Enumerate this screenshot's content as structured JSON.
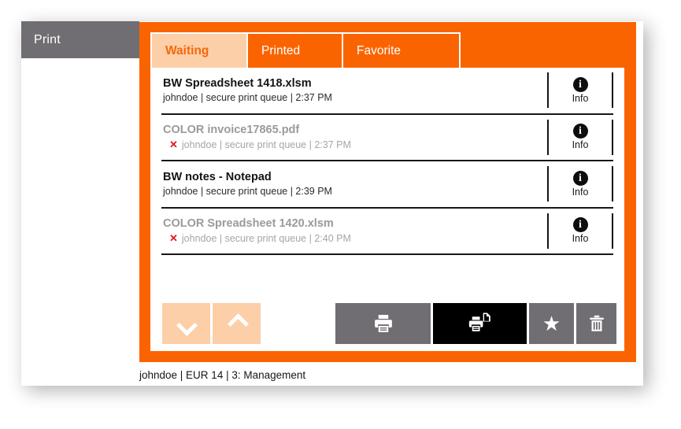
{
  "window": {
    "left_tab_label": "Print"
  },
  "tabs": [
    {
      "label": "Waiting",
      "active": true
    },
    {
      "label": "Printed",
      "active": false
    },
    {
      "label": "Favorite",
      "active": false
    }
  ],
  "job_list": {
    "info_label": "Info",
    "info_icon": "info-circle-icon",
    "error_mark": "✕",
    "items": [
      {
        "title": "BW Spreadsheet 1418.xlsm",
        "meta": "johndoe | secure print queue | 2:37 PM",
        "error": false,
        "state": "ready"
      },
      {
        "title": "COLOR invoice17865.pdf",
        "meta": "johndoe | secure print queue | 2:37 PM",
        "error": true,
        "state": "disabled"
      },
      {
        "title": "BW notes - Notepad",
        "meta": "johndoe | secure print queue | 2:39 PM",
        "error": false,
        "state": "ready"
      },
      {
        "title": "COLOR Spreadsheet 1420.xlsm",
        "meta": "johndoe | secure print queue | 2:40 PM",
        "error": true,
        "state": "disabled"
      }
    ]
  },
  "toolbar": {
    "scroll_down": {
      "name": "scroll-down-button",
      "icon": "chevron-down-icon"
    },
    "scroll_up": {
      "name": "scroll-up-button",
      "icon": "chevron-up-icon"
    },
    "print": {
      "name": "print-button",
      "icon": "printer-icon"
    },
    "print_copies": {
      "name": "print-and-keep-button",
      "icon": "printer-copy-icon",
      "selected": true
    },
    "favorite": {
      "name": "favorite-button",
      "icon": "star-icon"
    },
    "delete": {
      "name": "delete-button",
      "icon": "trash-icon"
    }
  },
  "status_bar": {
    "text": "johndoe | EUR 14 | 3: Management"
  },
  "colors": {
    "brand_orange": "#FA6400",
    "tab_active": "#FCCFA8",
    "grey_button": "#706E72",
    "black_button": "#000000",
    "error_red": "#E01B1B"
  }
}
